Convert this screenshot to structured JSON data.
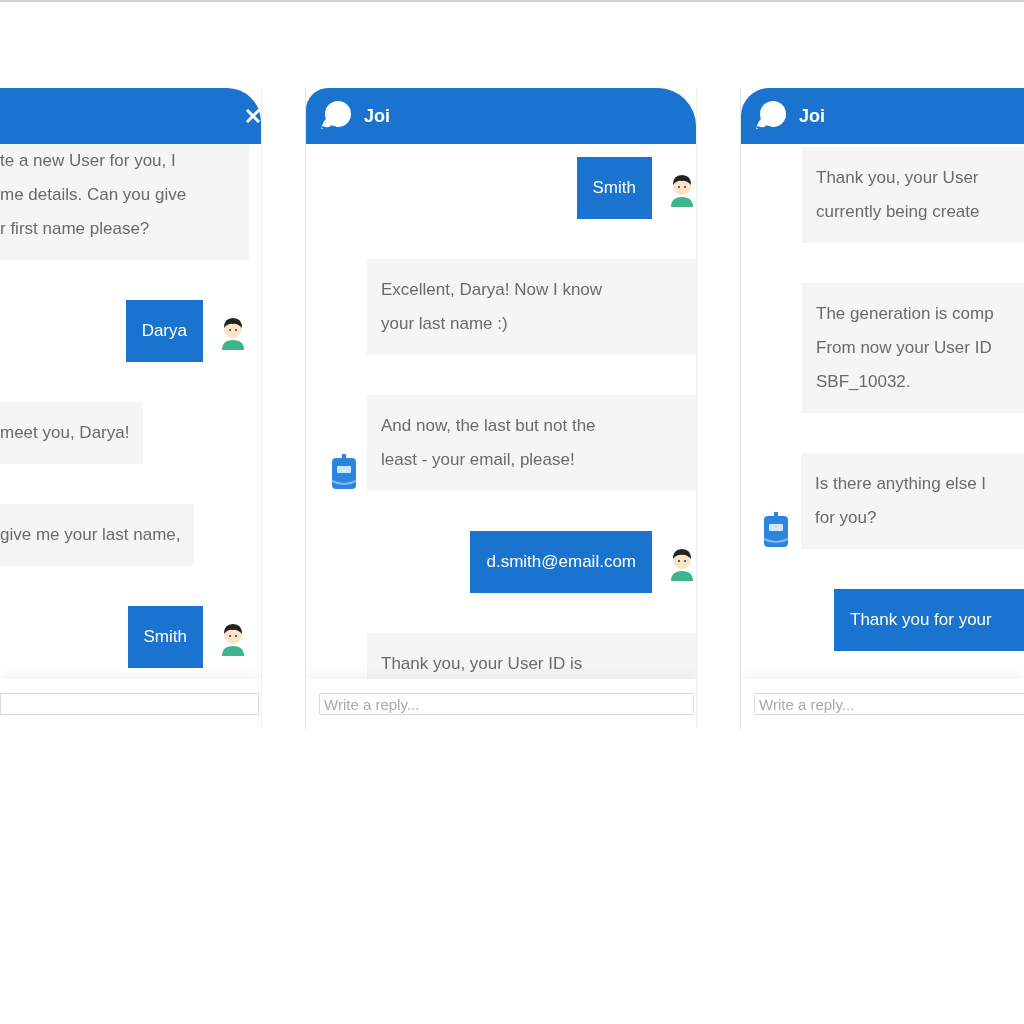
{
  "panels": [
    {
      "header": {
        "logo": false,
        "close_button": true
      },
      "messages": [
        {
          "kind": "bot",
          "text": "te a new User for you, I\nme details. Can you give\nr first name please?",
          "avatar": false
        },
        {
          "kind": "user",
          "text": "Darya",
          "avatar": true
        },
        {
          "kind": "bot",
          "text": "meet you, Darya!",
          "avatar": false
        },
        {
          "kind": "bot",
          "text": "give me your last name,",
          "avatar": false
        },
        {
          "kind": "user",
          "text": "Smith",
          "avatar": true
        }
      ]
    },
    {
      "header": {
        "logo": true,
        "title": "Joi",
        "close_button": false
      },
      "messages": [
        {
          "kind": "user",
          "text": "Smith",
          "avatar": true
        },
        {
          "kind": "bot",
          "text": "Excellent, Darya! Now I know\nyour last name :)",
          "avatar": false
        },
        {
          "kind": "bot",
          "text": "And now, the last but not the\nleast - your email, please!",
          "avatar": true
        },
        {
          "kind": "user",
          "text": "d.smith@email.com",
          "avatar": true
        },
        {
          "kind": "bot",
          "text": "Thank you, your User ID is",
          "avatar": false
        }
      ],
      "input": {
        "placeholder": "Write a reply..."
      }
    },
    {
      "header": {
        "logo": true,
        "title": "Joi",
        "close_button": false
      },
      "messages": [
        {
          "kind": "bot",
          "text": "Thank you, your User\ncurrently being create",
          "avatar": false
        },
        {
          "kind": "bot",
          "text": "The generation is comp\nFrom now your User ID\nSBF_10032.",
          "avatar": false
        },
        {
          "kind": "bot",
          "text": "Is there anything else I\nfor you?",
          "avatar": true
        },
        {
          "kind": "user",
          "text": "Thank you for your",
          "avatar": false
        }
      ],
      "input": {
        "placeholder": "Write a reply..."
      }
    }
  ]
}
